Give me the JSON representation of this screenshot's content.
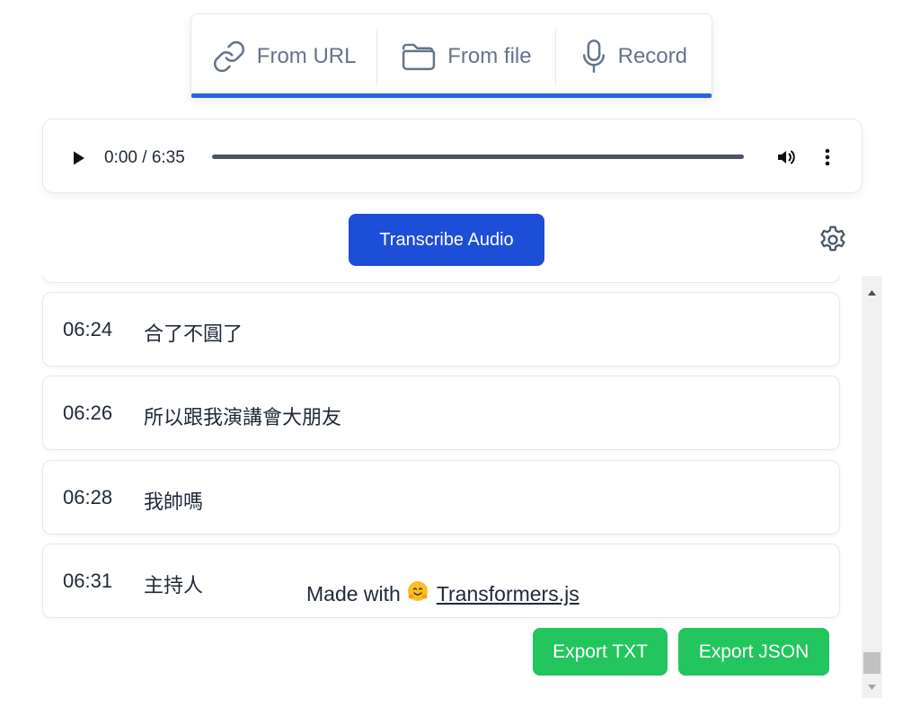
{
  "source_tabs": {
    "url_label": "From URL",
    "file_label": "From file",
    "record_label": "Record",
    "active_color": "#2563eb"
  },
  "player": {
    "time": "0:00 / 6:35",
    "progress": 0
  },
  "actions": {
    "transcribe_label": "Transcribe Audio"
  },
  "transcript": {
    "rows": [
      {
        "time": "06:24",
        "text": "合了不圓了"
      },
      {
        "time": "06:26",
        "text": "所以跟我演講會大朋友"
      },
      {
        "time": "06:28",
        "text": "我帥嗎"
      },
      {
        "time": "06:31",
        "text": "主持人"
      }
    ]
  },
  "footer": {
    "made_with": "Made with",
    "link_label": "Transformers.js"
  },
  "export": {
    "txt_label": "Export TXT",
    "json_label": "Export JSON"
  },
  "colors": {
    "primary": "#1d4ed8",
    "export": "#22c55e"
  }
}
